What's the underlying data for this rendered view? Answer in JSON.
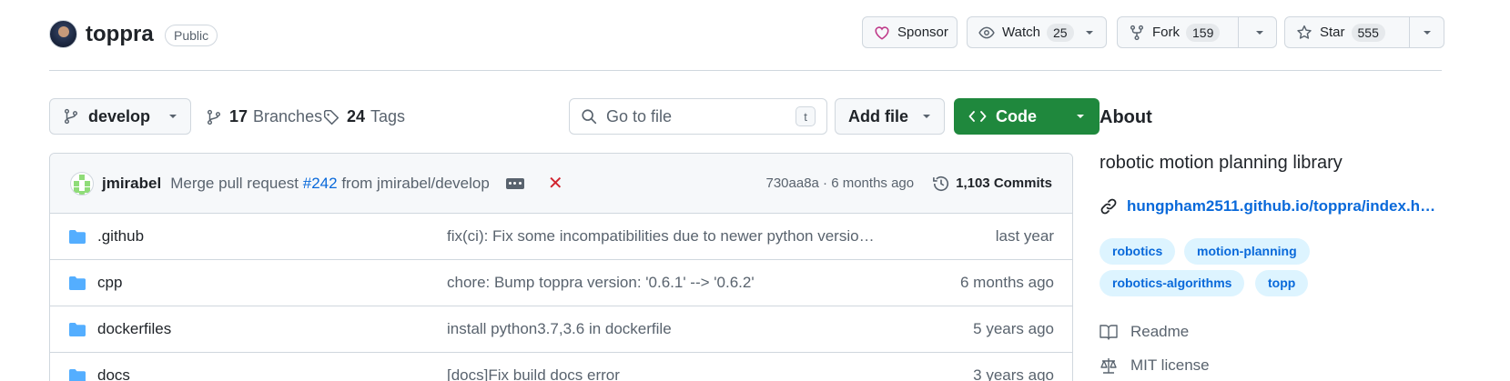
{
  "repo": {
    "name": "toppra",
    "visibility": "Public"
  },
  "actions": {
    "sponsor_label": "Sponsor",
    "watch_label": "Watch",
    "watch_count": "25",
    "fork_label": "Fork",
    "fork_count": "159",
    "star_label": "Star",
    "star_count": "555"
  },
  "toolbar": {
    "branch": "develop",
    "branches_count": "17",
    "branches_label": "Branches",
    "tags_count": "24",
    "tags_label": "Tags",
    "search_placeholder": "Go to file",
    "search_shortcut": "t",
    "add_file_label": "Add file",
    "code_label": "Code"
  },
  "commit": {
    "author": "jmirabel",
    "message_prefix": "Merge pull request",
    "pr_link": "#242",
    "message_suffix": "from jmirabel/develop",
    "meta": "730aa8a · 6 months ago",
    "commits_label": "1,103 Commits"
  },
  "files": [
    {
      "name": ".github",
      "message": "fix(ci): Fix some incompatibilities due to newer python versio…",
      "when": "last year"
    },
    {
      "name": "cpp",
      "message": "chore: Bump toppra version: '0.6.1' --> '0.6.2'",
      "when": "6 months ago"
    },
    {
      "name": "dockerfiles",
      "message": "install python3.7,3.6 in dockerfile",
      "when": "5 years ago"
    },
    {
      "name": "docs",
      "message": "[docs]Fix build docs error",
      "when": "3 years ago"
    }
  ],
  "about": {
    "title": "About",
    "description": "robotic motion planning library",
    "link": "hungpham2511.github.io/toppra/index.h…",
    "topics": [
      "robotics",
      "motion-planning",
      "robotics-algorithms",
      "topp"
    ],
    "readme_label": "Readme",
    "license_label": "MIT license"
  },
  "colors": {
    "accent": "#0969da",
    "primary_button": "#1f883d",
    "sponsor": "#bf3989",
    "error": "#d1242f"
  }
}
